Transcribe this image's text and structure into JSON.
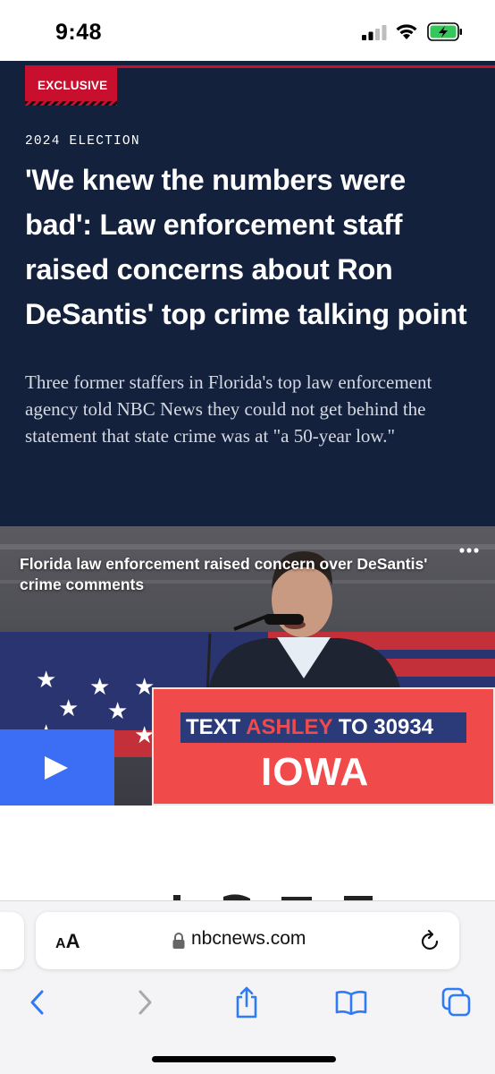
{
  "status_bar": {
    "time": "9:48"
  },
  "article": {
    "badge": "EXCLUSIVE",
    "section": "2024 ELECTION",
    "headline": "'We knew the numbers were bad': Law enforcement staff raised concerns about Ron DeSantis' top crime talking point",
    "dek": "Three former staffers in Florida's top law enforcement agency told NBC News they could not get behind the statement that state crime was at \"a 50-year low.\""
  },
  "video": {
    "title": "Florida law enforcement raised concern over DeSantis' crime comments",
    "sign_text_prefix": "TEXT ",
    "sign_text_name": "ASHLEY",
    "sign_text_suffix": " TO 30934",
    "sign_state": "IOWA"
  },
  "browser": {
    "address_aa_small": "A",
    "address_aa_big": "A",
    "url": "nbcnews.com"
  },
  "colors": {
    "header_bg": "#14213d",
    "accent_red": "#c8102e",
    "play_blue": "#3b6ef5",
    "ios_blue": "#2f7bf6"
  },
  "icons": [
    "signal-icon",
    "wifi-icon",
    "battery-icon",
    "more-icon",
    "play-icon",
    "lock-icon",
    "reload-icon",
    "back-icon",
    "forward-icon",
    "share-icon",
    "bookmarks-icon",
    "tabs-icon"
  ]
}
